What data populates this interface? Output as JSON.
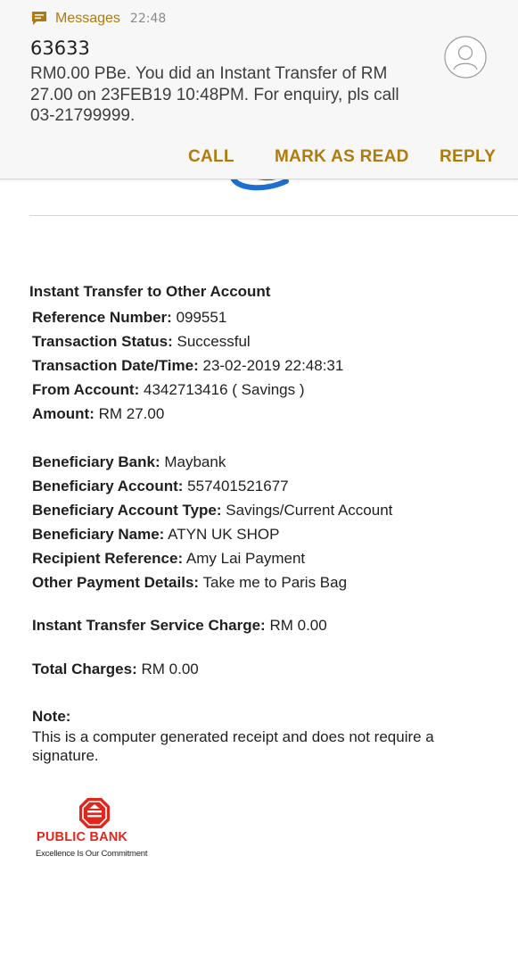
{
  "notification": {
    "app_name": "Messages",
    "time": "22:48",
    "sender": "63633",
    "body": "RM0.00 PBe. You did an Instant Transfer of RM 27.00 on 23FEB19 10:48PM. For enquiry, pls call 03-21799999.",
    "actions": {
      "call": "CALL",
      "mark_as_read": "MARK AS READ",
      "reply": "REPLY"
    },
    "accent_color": "#b07a0c"
  },
  "receipt": {
    "title": "Instant Transfer to Other Account",
    "reference_number": {
      "label": "Reference Number:",
      "value": "099551"
    },
    "transaction_status": {
      "label": "Transaction Status:",
      "value": "Successful"
    },
    "transaction_datetime": {
      "label": "Transaction Date/Time:",
      "value": "23-02-2019 22:48:31"
    },
    "from_account": {
      "label": "From Account:",
      "value": "4342713416 ( Savings )"
    },
    "amount": {
      "label": "Amount:",
      "value": "RM 27.00"
    },
    "beneficiary_bank": {
      "label": "Beneficiary Bank:",
      "value": "Maybank"
    },
    "beneficiary_account": {
      "label": "Beneficiary Account:",
      "value": "557401521677"
    },
    "beneficiary_account_type": {
      "label": "Beneficiary Account Type:",
      "value": "Savings/Current Account"
    },
    "beneficiary_name": {
      "label": "Beneficiary Name:",
      "value": "ATYN UK SHOP"
    },
    "recipient_reference": {
      "label": "Recipient Reference:",
      "value": "Amy Lai Payment"
    },
    "other_payment_details": {
      "label": "Other Payment Details:",
      "value": "Take me to Paris Bag"
    },
    "service_charge": {
      "label": "Instant Transfer Service Charge:",
      "value": "RM 0.00"
    },
    "total_charges": {
      "label": "Total Charges:",
      "value": "RM 0.00"
    },
    "note_label": "Note:",
    "note_text": "This is a computer generated receipt and does not require a signature."
  },
  "bank_logo": {
    "name": "PUBLIC BANK",
    "tagline": "Excellence Is Our Commitment",
    "brand_color": "#e2261c"
  }
}
